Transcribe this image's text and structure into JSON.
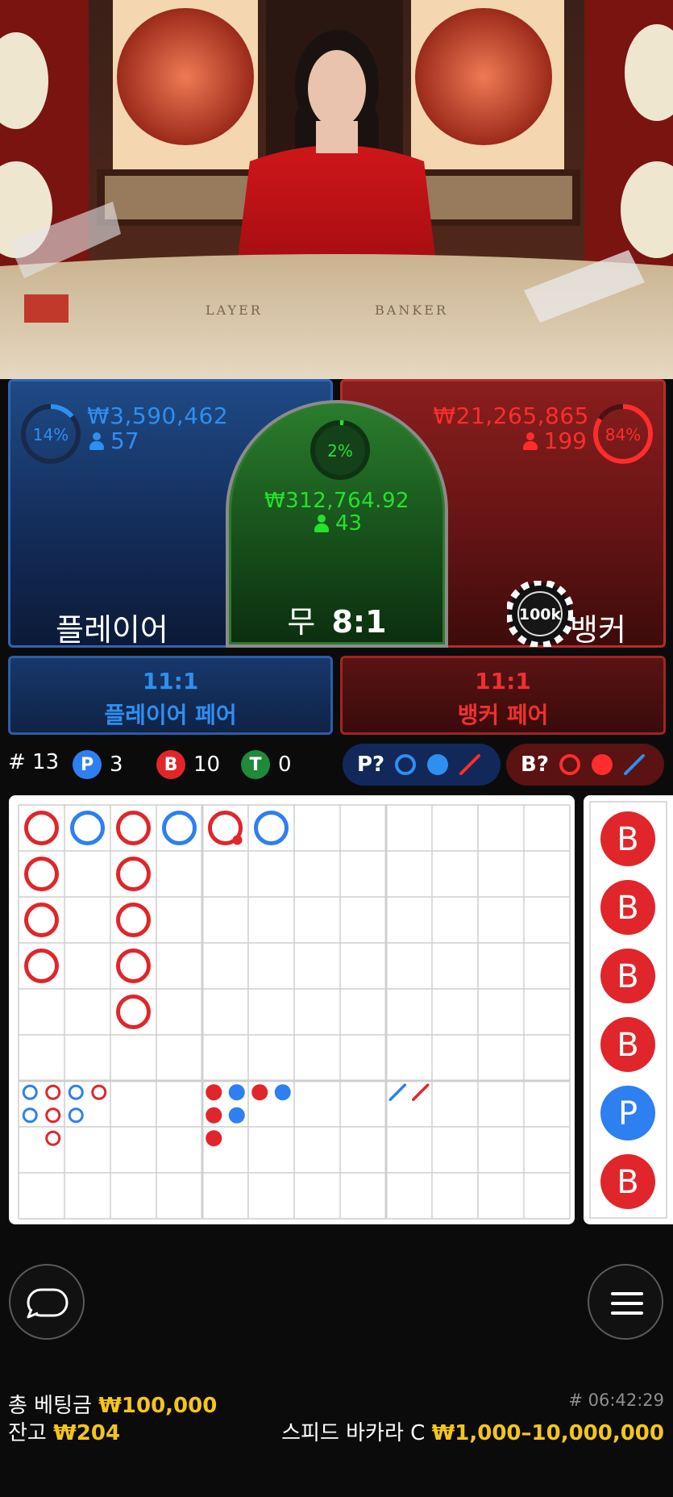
{
  "video": {
    "table_text_left": "LAYER",
    "table_text_right": "BANKER"
  },
  "player": {
    "percent": "14%",
    "percent_value": 14,
    "amount": "₩3,590,462",
    "count": "57",
    "label": "플레이어",
    "color": "#2e8ff0"
  },
  "tie": {
    "percent": "2%",
    "percent_value": 2,
    "amount": "₩312,764.92",
    "count": "43",
    "label_prefix": "무",
    "odds": "8:1",
    "color": "#28e02e"
  },
  "banker": {
    "percent": "84%",
    "percent_value": 84,
    "amount": "₩21,265,865",
    "count": "199",
    "label": "뱅커",
    "chip": "100k",
    "color": "#ff2d2d"
  },
  "player_pair": {
    "odds": "11:1",
    "name": "플레이어 페어"
  },
  "banker_pair": {
    "odds": "11:1",
    "name": "뱅커 페어"
  },
  "stats": {
    "round_label": "# 13",
    "player_badge": "P",
    "player_count": "3",
    "banker_badge": "B",
    "banker_count": "10",
    "tie_badge": "T",
    "tie_count": "0"
  },
  "predict": {
    "player_label": "P?",
    "banker_label": "B?"
  },
  "big_road": [
    {
      "col": 0,
      "row": 0,
      "color": "red"
    },
    {
      "col": 1,
      "row": 0,
      "color": "blue"
    },
    {
      "col": 2,
      "row": 0,
      "color": "red"
    },
    {
      "col": 3,
      "row": 0,
      "color": "blue"
    },
    {
      "col": 4,
      "row": 0,
      "color": "red",
      "pair_dot": true
    },
    {
      "col": 5,
      "row": 0,
      "color": "blue"
    },
    {
      "col": 0,
      "row": 1,
      "color": "red"
    },
    {
      "col": 2,
      "row": 1,
      "color": "red"
    },
    {
      "col": 0,
      "row": 2,
      "color": "red"
    },
    {
      "col": 2,
      "row": 2,
      "color": "red"
    },
    {
      "col": 0,
      "row": 3,
      "color": "red"
    },
    {
      "col": 2,
      "row": 3,
      "color": "red"
    },
    {
      "col": 2,
      "row": 4,
      "color": "red"
    }
  ],
  "big_eye_road": [
    {
      "col": 0,
      "row": 0,
      "color": "blue"
    },
    {
      "col": 1,
      "row": 0,
      "color": "red"
    },
    {
      "col": 2,
      "row": 0,
      "color": "blue"
    },
    {
      "col": 3,
      "row": 0,
      "color": "red"
    },
    {
      "col": 0,
      "row": 1,
      "color": "blue"
    },
    {
      "col": 1,
      "row": 1,
      "color": "red"
    },
    {
      "col": 2,
      "row": 1,
      "color": "blue"
    },
    {
      "col": 1,
      "row": 2,
      "color": "red"
    }
  ],
  "small_road": [
    {
      "col": 0,
      "row": 0,
      "color": "red"
    },
    {
      "col": 1,
      "row": 0,
      "color": "blue"
    },
    {
      "col": 2,
      "row": 0,
      "color": "red"
    },
    {
      "col": 3,
      "row": 0,
      "color": "blue"
    },
    {
      "col": 0,
      "row": 1,
      "color": "red"
    },
    {
      "col": 1,
      "row": 1,
      "color": "blue"
    },
    {
      "col": 0,
      "row": 2,
      "color": "red"
    }
  ],
  "cockroach_road": [
    {
      "col": 0,
      "row": 0,
      "color": "blue"
    },
    {
      "col": 1,
      "row": 0,
      "color": "red"
    }
  ],
  "bead_road": [
    "B",
    "B",
    "B",
    "B",
    "P",
    "B"
  ],
  "footer": {
    "total_bet_label": "총 베팅금",
    "total_bet_value": "₩100,000",
    "balance_label": "잔고",
    "balance_value": "₩204",
    "round_id": "# 06:42:29",
    "table_name": "스피드 바카라 C",
    "limits": "₩1,000–10,000,000"
  },
  "icons": {
    "chat": "chat-bubble-icon",
    "menu": "hamburger-menu-icon"
  }
}
